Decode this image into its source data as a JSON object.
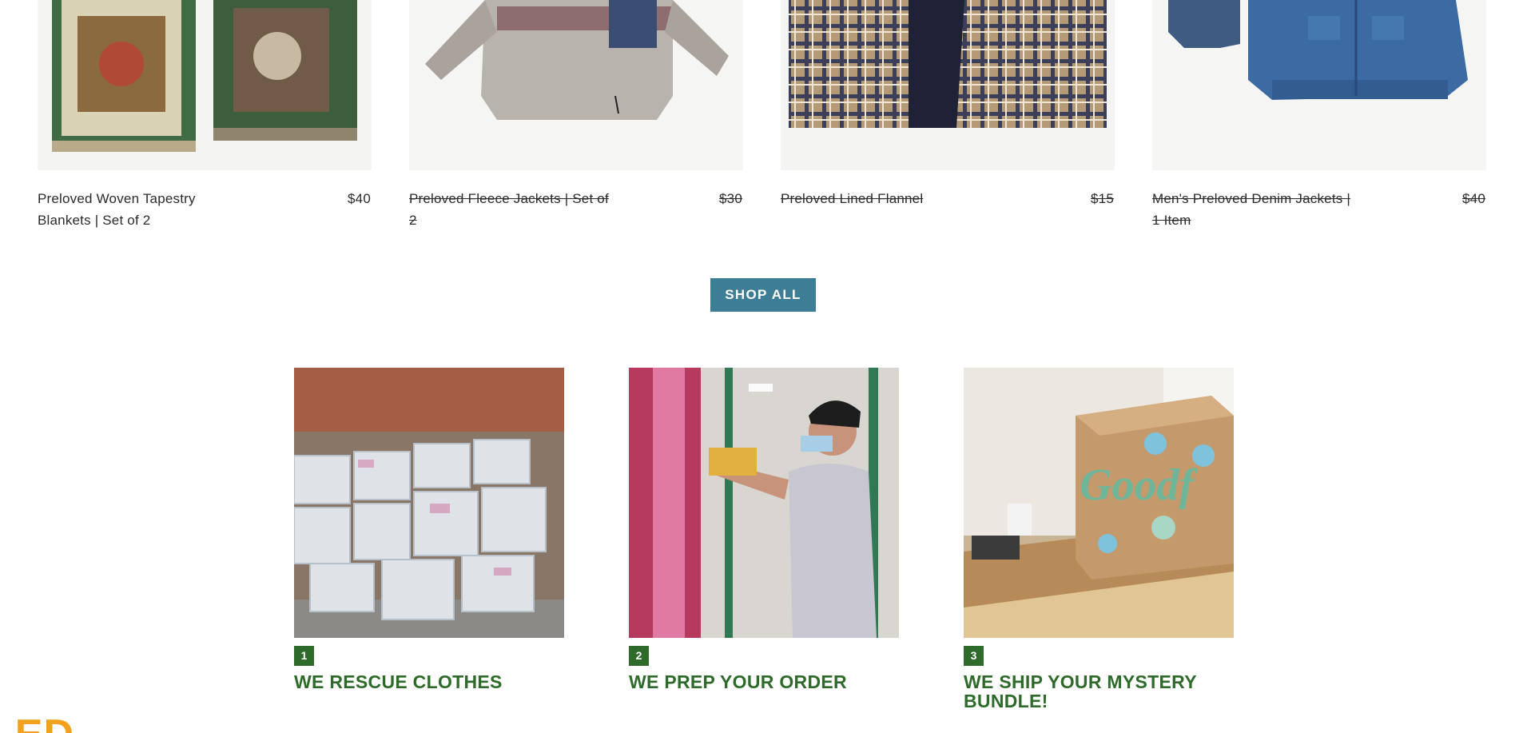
{
  "products": [
    {
      "title": "Preloved Woven Tapestry Blankets | Set of 2",
      "price": "$40",
      "strikethrough": false
    },
    {
      "title": "Preloved Fleece Jackets | Set of 2",
      "price": "$30",
      "strikethrough": true
    },
    {
      "title": "Preloved Lined Flannel",
      "price": "$15",
      "strikethrough": true
    },
    {
      "title": "Men's Preloved Denim Jackets | 1 Item",
      "price": "$40",
      "strikethrough": true
    }
  ],
  "shop_all_label": "SHOP ALL",
  "steps": [
    {
      "number": "1",
      "title": "WE RESCUE CLOTHES"
    },
    {
      "number": "2",
      "title": "WE PREP YOUR ORDER"
    },
    {
      "number": "3",
      "title": "WE SHIP YOUR MYSTERY BUNDLE!"
    }
  ],
  "logo_fragment": "LED",
  "colors": {
    "button_blue": "#3d7d95",
    "step_green": "#2e6b2a",
    "logo_orange": "#f2a11e"
  }
}
